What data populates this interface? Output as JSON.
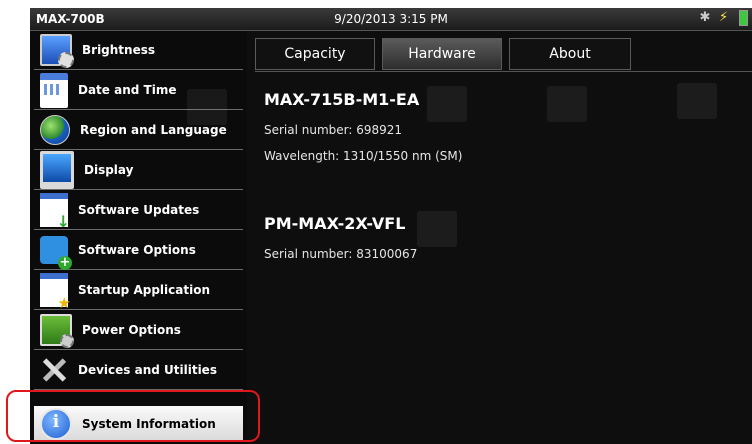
{
  "titlebar": {
    "device": "MAX-700B",
    "datetime": "9/20/2013 3:15 PM"
  },
  "sidebar": {
    "items": [
      {
        "label": "Brightness",
        "icon": "brightness-icon"
      },
      {
        "label": "Date and Time",
        "icon": "calendar-icon"
      },
      {
        "label": "Region and Language",
        "icon": "globe-icon"
      },
      {
        "label": "Display",
        "icon": "display-icon"
      },
      {
        "label": "Software Updates",
        "icon": "software-update-icon"
      },
      {
        "label": "Software Options",
        "icon": "software-options-icon"
      },
      {
        "label": "Startup Application",
        "icon": "startup-app-icon"
      },
      {
        "label": "Power Options",
        "icon": "power-options-icon"
      },
      {
        "label": "Devices and Utilities",
        "icon": "tools-icon"
      },
      {
        "label": "System Information",
        "icon": "info-icon",
        "selected": true
      }
    ]
  },
  "tabs": {
    "capacity": "Capacity",
    "hardware": "Hardware",
    "about": "About",
    "active": "Hardware"
  },
  "modules": [
    {
      "name": "MAX-715B-M1-EA",
      "serial": "Serial number: 698921",
      "wavelength": "Wavelength: 1310/1550 nm (SM)"
    },
    {
      "name": "PM-MAX-2X-VFL",
      "serial": "Serial number: 83100067"
    }
  ],
  "colors": {
    "highlight": "#e2171b",
    "background": "#0e0e0e",
    "selected_item": "#e9e9e9"
  }
}
